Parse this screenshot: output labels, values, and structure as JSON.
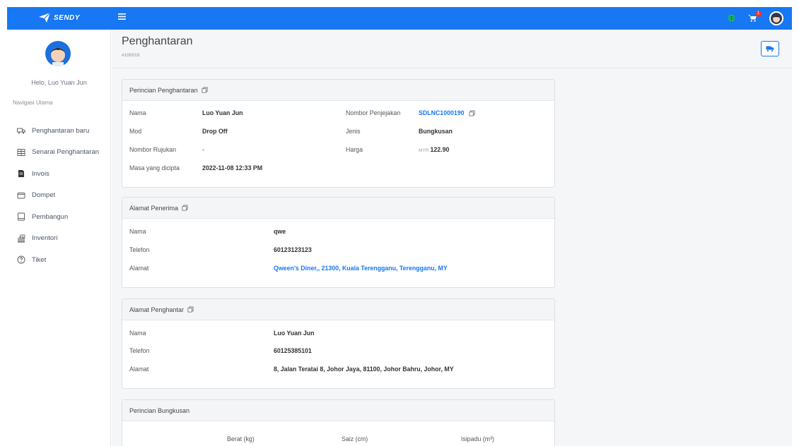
{
  "brand": {
    "name": "SENDY"
  },
  "header": {
    "cart_count": "1"
  },
  "sidebar": {
    "greeting": "Helo, Luo Yuan Jun",
    "nav_title": "Navigasi Utama",
    "items": [
      {
        "label": "Penghantaran baru",
        "icon": "truck-icon"
      },
      {
        "label": "Senarai Penghantaran",
        "icon": "list-icon"
      },
      {
        "label": "Invois",
        "icon": "invoice-icon"
      },
      {
        "label": "Dompet",
        "icon": "wallet-icon"
      },
      {
        "label": "Pembangun",
        "icon": "developer-icon"
      },
      {
        "label": "Inventori",
        "icon": "inventory-icon"
      },
      {
        "label": "Tiket",
        "icon": "ticket-icon"
      }
    ]
  },
  "page": {
    "title": "Penghantaran",
    "id": "#100019"
  },
  "delivery_details": {
    "title": "Perincian Penghantaran",
    "nama_label": "Nama",
    "nama": "Luo Yuan Jun",
    "mod_label": "Mod",
    "mod": "Drop Off",
    "rujukan_label": "Nombor Rujukan",
    "rujukan": "-",
    "masa_label": "Masa yang dicipta",
    "masa": "2022-11-08 12:33 PM",
    "tracking_label": "Nombor Penjejakan",
    "tracking": "SDLNC1000190",
    "jenis_label": "Jenis",
    "jenis": "Bungkusan",
    "harga_label": "Harga",
    "currency": "MYR",
    "harga": "122.90"
  },
  "recipient": {
    "title": "Alamat Penerima",
    "nama_label": "Nama",
    "nama": "qwe",
    "telefon_label": "Telefon",
    "telefon": "60123123123",
    "alamat_label": "Alamat",
    "alamat": "Qween's Diner,, 21300, Kuala Terengganu, Terengganu, MY"
  },
  "sender": {
    "title": "Alamat Penghantar",
    "nama_label": "Nama",
    "nama": "Luo Yuan Jun",
    "telefon_label": "Telefon",
    "telefon": "60125385101",
    "alamat_label": "Alamat",
    "alamat": "8, Jalan Teratai 8, Johor Jaya, 81100, Johor Bahru, Johor, MY"
  },
  "parcel": {
    "title": "Perincian Bungkusan",
    "columns": [
      "Berat (kg)",
      "Saiz (cm)",
      "Isipadu (m³)"
    ]
  },
  "colors": {
    "primary": "#1877f2",
    "globe": "#1ec27a"
  }
}
